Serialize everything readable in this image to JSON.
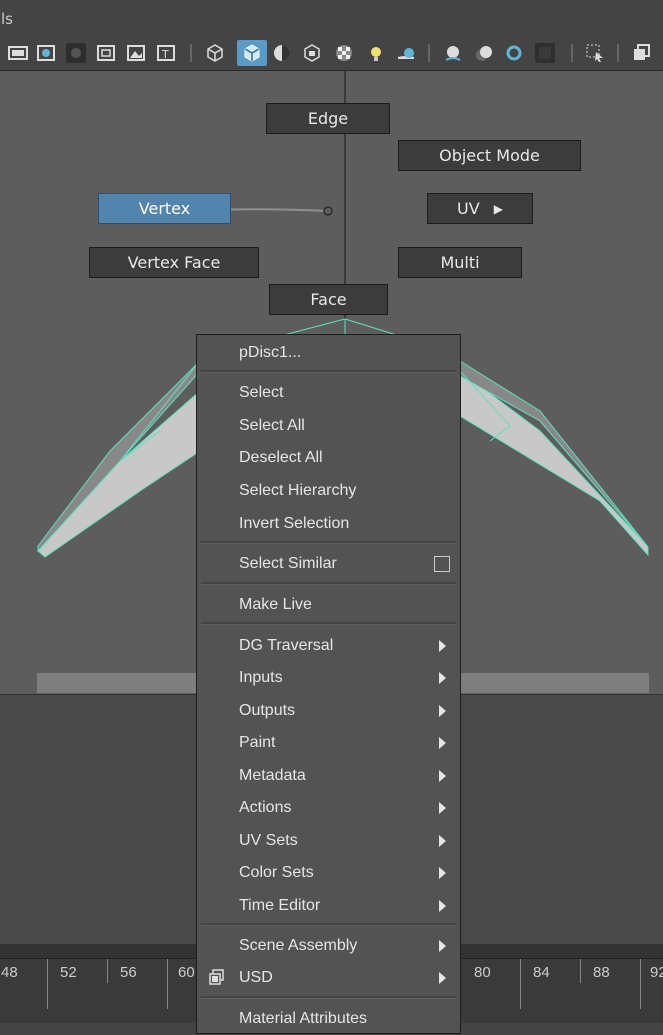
{
  "menubar": {
    "title": "ls"
  },
  "toolbar": {
    "icons": [
      "film-strip-icon",
      "display-texture-icon",
      "dark-square-icon",
      "resolution-gate-icon",
      "image-plane-icon",
      "texture-icon",
      "wireframe-cube-icon",
      "shaded-cube-icon",
      "shadow-sphere-icon",
      "textured-cube-icon",
      "checker-icon",
      "light-bulb-icon",
      "ambient-occlusion-icon",
      "motion-blur-icon",
      "anti-alias-icon",
      "depth-of-field-icon",
      "isolate-select-icon",
      "xray-icon",
      "panel-layout-icon"
    ]
  },
  "marking_menu": {
    "edge": "Edge",
    "object_mode": "Object Mode",
    "vertex": "Vertex",
    "uv": "UV",
    "vertex_face": "Vertex Face",
    "multi": "Multi",
    "face": "Face"
  },
  "context_menu": {
    "header": "pDisc1...",
    "items": [
      {
        "label": "Select"
      },
      {
        "label": "Select All"
      },
      {
        "label": "Deselect All"
      },
      {
        "label": "Select Hierarchy"
      },
      {
        "label": "Invert Selection"
      },
      {
        "label": "Select Similar"
      },
      {
        "label": "Make Live"
      },
      {
        "label": "DG Traversal"
      },
      {
        "label": "Inputs"
      },
      {
        "label": "Outputs"
      },
      {
        "label": "Paint"
      },
      {
        "label": "Metadata"
      },
      {
        "label": "Actions"
      },
      {
        "label": "UV Sets"
      },
      {
        "label": "Color Sets"
      },
      {
        "label": "Time Editor"
      },
      {
        "label": "Scene Assembly"
      },
      {
        "label": "USD"
      },
      {
        "label": "Material Attributes"
      }
    ]
  },
  "timeline": {
    "frames": [
      "48",
      "52",
      "56",
      "60",
      "80",
      "84",
      "88",
      "92"
    ]
  },
  "colors": {
    "accent_selected": "#5284ae",
    "wire_highlight": "#5fe0c0",
    "range_marker": "#3dd33d"
  }
}
